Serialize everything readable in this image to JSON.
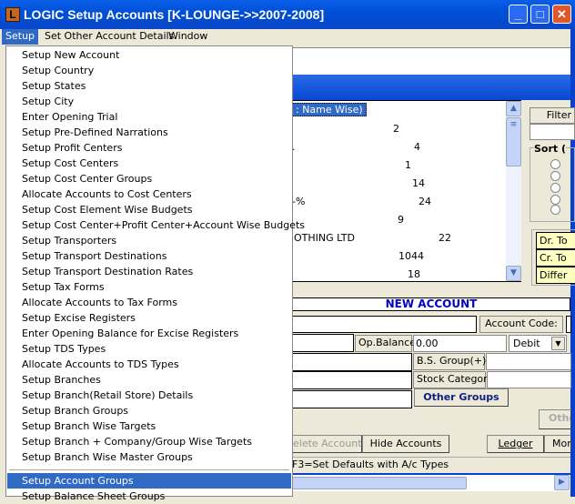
{
  "window": {
    "title": "LOGIC Setup Accounts  [K-LOUNGE->>2007-2008]",
    "app_icon_letter": "L"
  },
  "menubar": [
    "Setup",
    "Set Other Account Details",
    "Window"
  ],
  "setup_menu": {
    "items": [
      "Setup New Account",
      "Setup Country",
      "Setup States",
      "Setup City",
      "Enter Opening Trial",
      "Setup Pre-Defined Narrations",
      "Setup Profit Centers",
      "Setup Cost Centers",
      "Setup Cost Center Groups",
      "Allocate Accounts to Cost Centers",
      "Setup Cost Element Wise Budgets",
      "Setup Cost Center+Profit Center+Account Wise Budgets",
      "Setup Transporters",
      "Setup Transport Destinations",
      "Setup Transport Destination Rates",
      "Setup Tax Forms",
      "Allocate Accounts to Tax Forms",
      "Setup Excise Registers",
      "Enter Opening Balance for Excise Registers",
      "Setup TDS Types",
      "Allocate Accounts to TDS Types",
      "Setup Branches",
      "Setup Branch(Retail Store) Details",
      "Setup Branch Groups",
      "Setup Branch Wise Targets",
      "Setup Branch + Company/Group Wise Targets",
      "Setup Branch Wise Master Groups"
    ],
    "after_separator": [
      "Setup Account Groups",
      "Setup Balance Sheet Groups"
    ],
    "selected": "Setup Account Groups"
  },
  "list": {
    "header": ": Name Wise)",
    "rows": [
      {
        "name": "",
        "value": "2"
      },
      {
        "name": ".",
        "value": "4"
      },
      {
        "name": "",
        "value": "1"
      },
      {
        "name": "",
        "value": "14"
      },
      {
        "name": "-%",
        "value": "24"
      },
      {
        "name": "",
        "value": "9"
      },
      {
        "name": "OTHING LTD",
        "value": "22"
      },
      {
        "name": "",
        "value": "1044"
      },
      {
        "name": "",
        "value": "18"
      }
    ]
  },
  "right_panel": {
    "filter_label": "Filter",
    "sort_label": "Sort (",
    "totals": [
      "Dr. To",
      "Cr. To",
      "Differ"
    ]
  },
  "form": {
    "header": "NEW ACCOUNT",
    "account_code_label": "Account Code:",
    "op_balance_label": "Op.Balance:",
    "op_balance_value": "0.00",
    "dr_cr_value": "Debit",
    "bs_group_label": "B.S. Group(+)",
    "stock_category_label": "Stock Category",
    "other_groups_label": "Other Groups",
    "other_label": "Othe"
  },
  "buttons": {
    "delete": "elete Account",
    "hide": "Hide Accounts",
    "ledger": "Ledger",
    "more": "Mor"
  },
  "status": "F3=Set Defaults with A/c Types"
}
